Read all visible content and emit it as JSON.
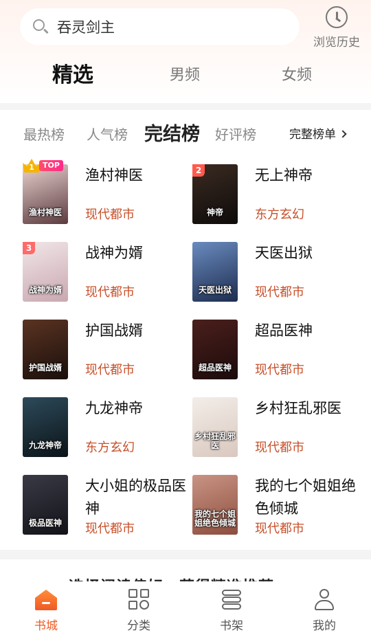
{
  "search": {
    "query": "吞灵剑主"
  },
  "history": {
    "label": "浏览历史"
  },
  "main_tabs": [
    {
      "label": "精选",
      "active": true
    },
    {
      "label": "男频",
      "active": false
    },
    {
      "label": "女频",
      "active": false
    }
  ],
  "rank_tabs": [
    {
      "label": "最热榜",
      "active": false
    },
    {
      "label": "人气榜",
      "active": false
    },
    {
      "label": "完结榜",
      "active": true
    },
    {
      "label": "好评榜",
      "active": false
    }
  ],
  "full_list_label": "完整榜单",
  "books": [
    {
      "rank": "1",
      "badge": "TOP",
      "title": "渔村神医",
      "genre": "现代都市",
      "cover_text": "渔村神医",
      "cover_colors": [
        "#e9d3d0",
        "#5b3a3e"
      ]
    },
    {
      "rank": "2",
      "title": "无上神帝",
      "genre": "东方玄幻",
      "cover_text": "神帝",
      "cover_colors": [
        "#3b2b22",
        "#0e0b0a"
      ]
    },
    {
      "rank": "3",
      "title": "战神为婿",
      "genre": "现代都市",
      "cover_text": "战神为婿",
      "cover_colors": [
        "#f1e6e8",
        "#c9a8b0"
      ]
    },
    {
      "title": "天医出狱",
      "genre": "现代都市",
      "cover_text": "天医出狱",
      "cover_colors": [
        "#6a8bbf",
        "#1d2d4f"
      ]
    },
    {
      "title": "护国战婿",
      "genre": "现代都市",
      "cover_text": "护国战婿",
      "cover_colors": [
        "#5a3322",
        "#1a0f0b"
      ]
    },
    {
      "title": "超品医神",
      "genre": "现代都市",
      "cover_text": "超品医神",
      "cover_colors": [
        "#4a1f1c",
        "#1c0b0b"
      ]
    },
    {
      "title": "九龙神帝",
      "genre": "东方玄幻",
      "cover_text": "九龙神帝",
      "cover_colors": [
        "#2d4a5a",
        "#0b1418"
      ]
    },
    {
      "title": "乡村狂乱邪医",
      "genre": "现代都市",
      "cover_text": "乡村狂乱邪医",
      "cover_colors": [
        "#f3ede8",
        "#d9c8bf"
      ]
    },
    {
      "title": "大小姐的极品医神",
      "genre": "现代都市",
      "cover_text": "极品医神",
      "cover_colors": [
        "#3a3a46",
        "#121218"
      ]
    },
    {
      "title": "我的七个姐姐绝色倾城",
      "genre": "现代都市",
      "cover_text": "我的七个姐姐绝色倾城",
      "cover_colors": [
        "#c99484",
        "#8c4d3d"
      ]
    }
  ],
  "peek_text": "选择阅读偏好，获得精准推荐",
  "bottom_nav": [
    {
      "label": "书城",
      "icon": "home-icon",
      "active": true
    },
    {
      "label": "分类",
      "icon": "category-icon",
      "active": false
    },
    {
      "label": "书架",
      "icon": "bookshelf-icon",
      "active": false
    },
    {
      "label": "我的",
      "icon": "profile-icon",
      "active": false
    }
  ],
  "colors": {
    "accent": "#ef5a25",
    "genre": "#c8502a",
    "badge_top": "#f6b400",
    "badge_2": "#ff5a4e",
    "badge_3": "#ff6b6b"
  }
}
